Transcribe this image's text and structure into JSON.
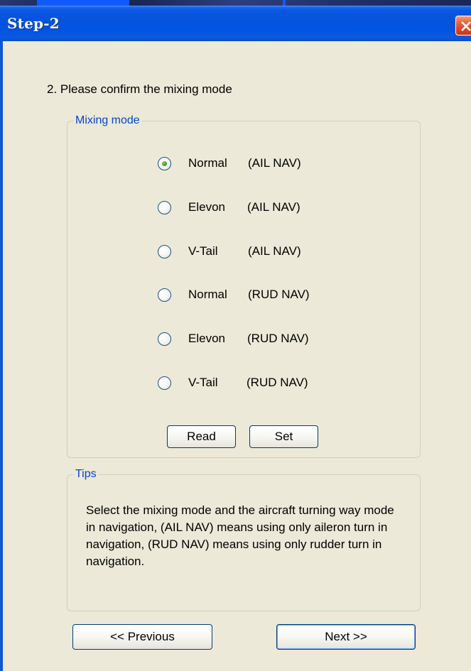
{
  "window": {
    "title": "Step-2",
    "close_icon": "close-icon"
  },
  "content": {
    "prompt": "2. Please confirm the mixing mode"
  },
  "mixing_mode": {
    "group_title": "Mixing mode",
    "selected_index": 0,
    "options": [
      {
        "mode": "Normal",
        "nav": "(AIL NAV)",
        "selected": true
      },
      {
        "mode": "Elevon",
        "nav": "(AIL NAV)",
        "selected": false
      },
      {
        "mode": "V-Tail",
        "nav": "(AIL NAV)",
        "selected": false
      },
      {
        "mode": "Normal",
        "nav": "(RUD NAV)",
        "selected": false
      },
      {
        "mode": "Elevon",
        "nav": "(RUD NAV)",
        "selected": false
      },
      {
        "mode": "V-Tail",
        "nav": "(RUD NAV)",
        "selected": false
      }
    ],
    "buttons": {
      "read": "Read",
      "set": "Set"
    }
  },
  "tips": {
    "group_title": "Tips",
    "text": "Select the mixing mode and the aircraft turning way mode in navigation, (AIL NAV) means using only aileron turn in navigation, (RUD NAV) means using only rudder turn in navigation."
  },
  "navigation": {
    "previous": "<< Previous",
    "next": "Next  >>"
  },
  "colors": {
    "titlebar": "#0054e3",
    "dialog_background": "#ece9d8",
    "group_title": "#0046d5",
    "close_button": "#e56441",
    "selected_radio": "#3fa51d"
  }
}
